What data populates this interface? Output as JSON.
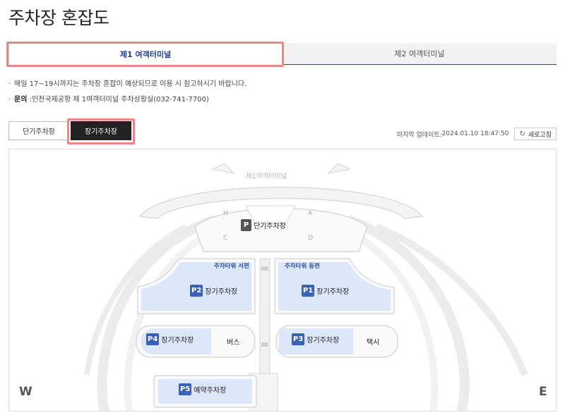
{
  "page_title": "주차장 혼잡도",
  "tabs": [
    {
      "label": "제1 여객터미널",
      "active": true
    },
    {
      "label": "제2 여객터미널",
      "active": false
    }
  ],
  "notes": {
    "congestion": "매일 17~19시까지는 주차장 혼잡이 예상되므로 이용 시 참고하시기 바랍니다.",
    "inquiry_label": "문의",
    "inquiry_text": " :인천국제공항 제 1여객터미널 주차상황실(032-741-7700)"
  },
  "lot_toggle": {
    "short_term": "단기주차장",
    "long_term": "장기주차장",
    "selected": "장기주차장"
  },
  "last_update": {
    "label": "마지막 업데이트:",
    "value": "2024.01.10 18:47:50"
  },
  "refresh_label": "새로고침",
  "map": {
    "terminal": "제1여객터미널",
    "gates": {
      "h": "H",
      "a": "A",
      "c": "C",
      "d": "D"
    },
    "short_term": {
      "badge": "P",
      "label": "단기주차장"
    },
    "towers": {
      "west": "주차타워 서편",
      "east": "주차타워 동편"
    },
    "lots": {
      "p1": {
        "badge": "P1",
        "label": "장기주차장"
      },
      "p2": {
        "badge": "P2",
        "label": "장기주차장"
      },
      "p3": {
        "badge": "P3",
        "label": "장기주차장",
        "side": "택시"
      },
      "p4": {
        "badge": "P4",
        "label": "장기주차장",
        "side": "버스"
      },
      "p5": {
        "badge": "P5",
        "label": "예약주차장"
      }
    },
    "compass": {
      "west": "W",
      "east": "E"
    },
    "colors": {
      "lot_fill": "#dce7fa",
      "badge": "#3a63b8",
      "road": "#ececec",
      "road_edge": "#cfcfcf"
    }
  }
}
